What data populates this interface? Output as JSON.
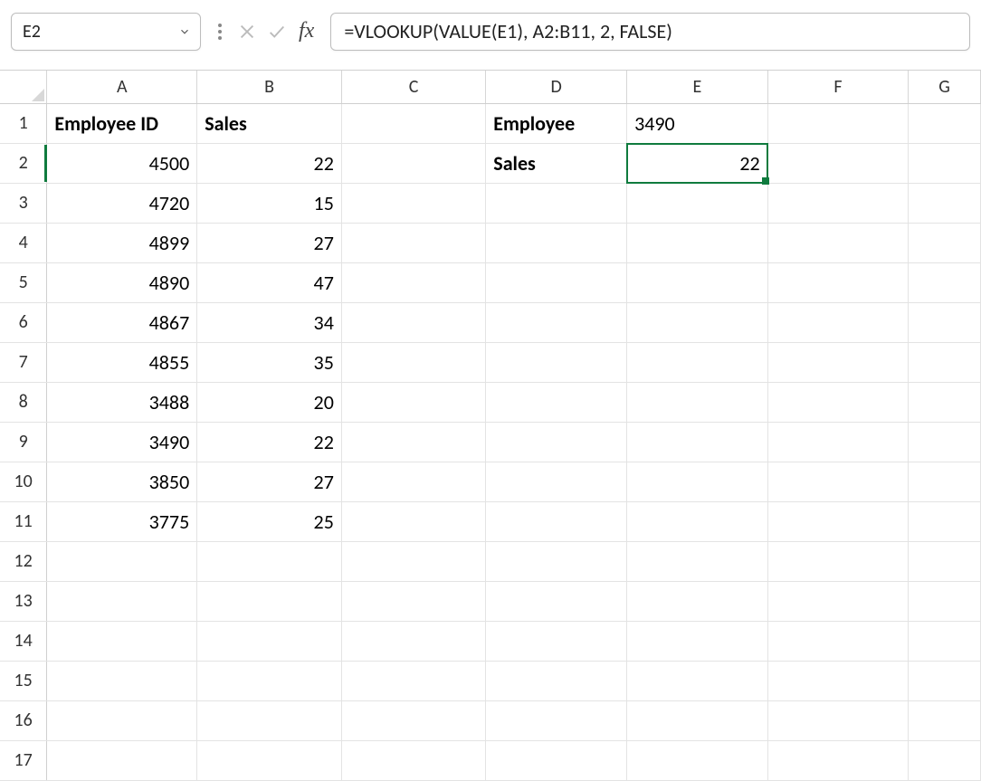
{
  "formula_bar": {
    "cell_ref": "E2",
    "formula": "=VLOOKUP(VALUE(E1), A2:B11, 2, FALSE)"
  },
  "columns": [
    "A",
    "B",
    "C",
    "D",
    "E",
    "F",
    "G"
  ],
  "row_count": 17,
  "active_cell": "E2",
  "headers": {
    "A1": "Employee ID",
    "B1": "Sales",
    "D1": "Employee",
    "D2": "Sales"
  },
  "lookup": {
    "E1": "3490",
    "E2": "22"
  },
  "table": {
    "A": [
      4500,
      4720,
      4899,
      4890,
      4867,
      4855,
      3488,
      3490,
      3850,
      3775
    ],
    "B": [
      22,
      15,
      27,
      47,
      34,
      35,
      20,
      22,
      27,
      25
    ]
  },
  "colors": {
    "selection": "#0f7b3e",
    "gridline": "#e3e3e3",
    "header_border": "#cfcfcf"
  }
}
